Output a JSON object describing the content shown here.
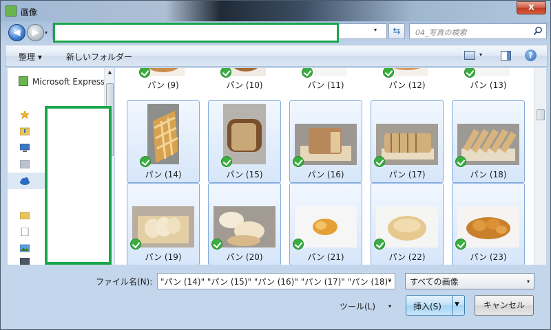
{
  "window": {
    "title": "画像",
    "close_label": "x"
  },
  "nav": {
    "drop": "▾"
  },
  "address": {
    "value": "",
    "dropdown": "▾"
  },
  "search": {
    "placeholder": "04_写真の検索"
  },
  "commandbar": {
    "organize_label": "整理 ▾",
    "new_folder_label": "新しいフォルダー",
    "help_label": "?"
  },
  "navpane": {
    "item_label": "Microsoft Express"
  },
  "tiles_top": [
    {
      "label": "パン (9)"
    },
    {
      "label": "パン (10)"
    },
    {
      "label": "パン (11)"
    },
    {
      "label": "パン (12)"
    },
    {
      "label": "パン (13)"
    }
  ],
  "tiles_row1": [
    {
      "label": "パン (14)"
    },
    {
      "label": "パン (15)"
    },
    {
      "label": "パン (16)"
    },
    {
      "label": "パン (17)"
    },
    {
      "label": "パン (18)"
    }
  ],
  "tiles_row2": [
    {
      "label": "パン (19)"
    },
    {
      "label": "パン (20)"
    },
    {
      "label": "パン (21)"
    },
    {
      "label": "パン (22)"
    },
    {
      "label": "パン (23)"
    }
  ],
  "footer": {
    "filename_label": "ファイル名(N):",
    "filename_value": "\"パン (14)\" \"パン (15)\" \"パン (16)\" \"パン (17)\" \"パン (18)\"",
    "filetype_value": "すべての画像",
    "tools_label": "ツール(L)",
    "insert_label": "挿入(S)",
    "cancel_label": "キャンセル"
  },
  "colors": {
    "selection": "#d6e6fa",
    "highlight": "#1aa64a",
    "check": "#3aae3f"
  }
}
